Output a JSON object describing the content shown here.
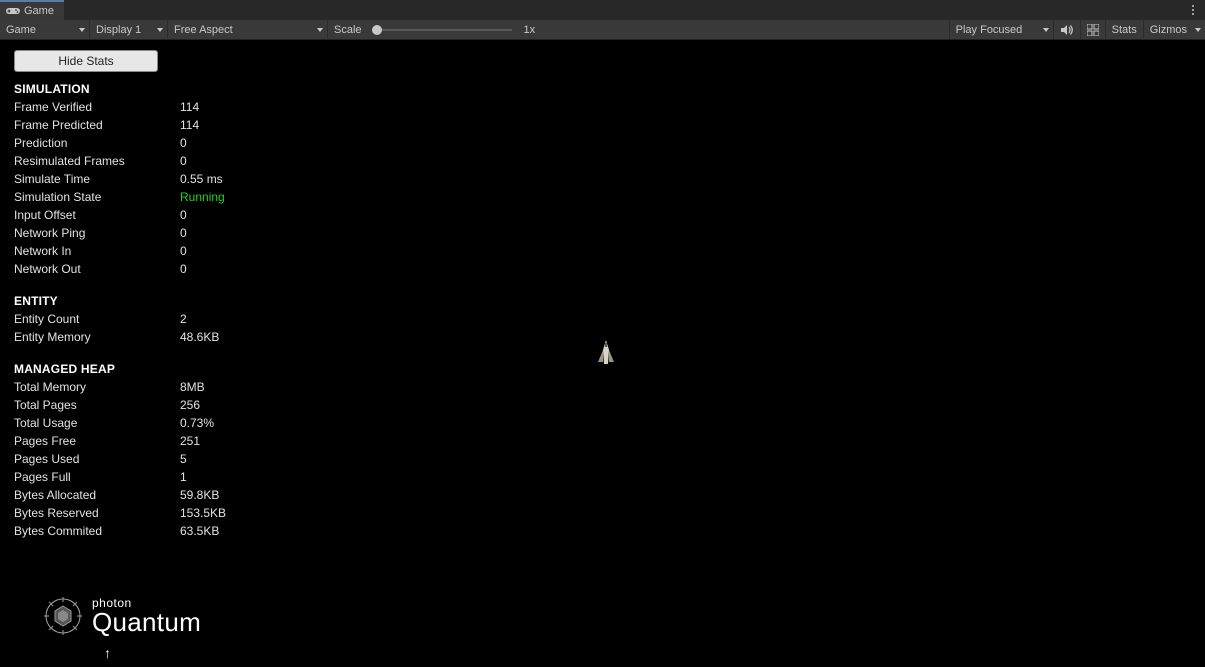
{
  "tab": {
    "title": "Game"
  },
  "toolbar": {
    "game": "Game",
    "display": "Display 1",
    "aspect": "Free Aspect",
    "scale_label": "Scale",
    "scale_value": "1x",
    "play_focused": "Play Focused",
    "stats": "Stats",
    "gizmos": "Gizmos"
  },
  "stats": {
    "hide_label": "Hide Stats",
    "sections": {
      "simulation": {
        "title": "SIMULATION",
        "rows": [
          {
            "label": "Frame Verified",
            "value": "114"
          },
          {
            "label": "Frame Predicted",
            "value": "114"
          },
          {
            "label": "Prediction",
            "value": "0"
          },
          {
            "label": "Resimulated Frames",
            "value": "0"
          },
          {
            "label": "Simulate Time",
            "value": "0.55 ms"
          },
          {
            "label": "Simulation State",
            "value": "Running",
            "highlight": true
          },
          {
            "label": "Input Offset",
            "value": "0"
          },
          {
            "label": "Network Ping",
            "value": "0"
          },
          {
            "label": "Network In",
            "value": "0"
          },
          {
            "label": "Network Out",
            "value": "0"
          }
        ]
      },
      "entity": {
        "title": "ENTITY",
        "rows": [
          {
            "label": "Entity Count",
            "value": "2"
          },
          {
            "label": "Entity Memory",
            "value": "48.6KB"
          }
        ]
      },
      "heap": {
        "title": "MANAGED HEAP",
        "rows": [
          {
            "label": "Total Memory",
            "value": "8MB"
          },
          {
            "label": "Total Pages",
            "value": "256"
          },
          {
            "label": "Total Usage",
            "value": "0.73%"
          },
          {
            "label": "Pages Free",
            "value": "251"
          },
          {
            "label": "Pages Used",
            "value": "5"
          },
          {
            "label": "Pages Full",
            "value": "1"
          },
          {
            "label": "Bytes Allocated",
            "value": "59.8KB"
          },
          {
            "label": "Bytes Reserved",
            "value": "153.5KB"
          },
          {
            "label": "Bytes Commited",
            "value": "63.5KB"
          }
        ]
      }
    }
  },
  "logo": {
    "line1": "photon",
    "line2": "Quantum"
  }
}
